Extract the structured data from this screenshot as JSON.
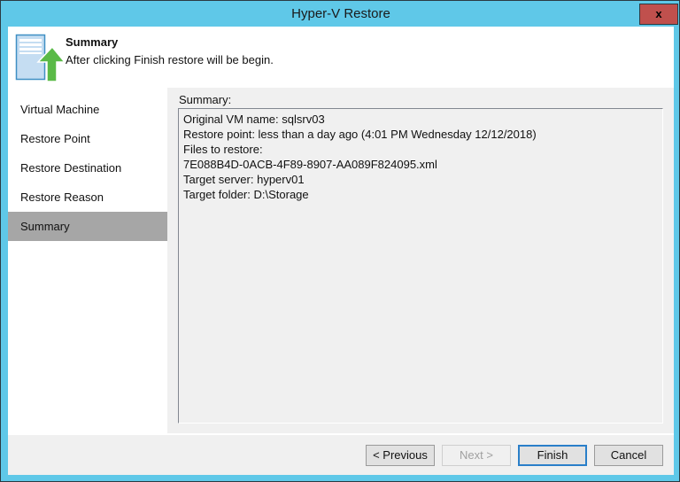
{
  "window": {
    "title": "Hyper-V Restore",
    "close_label": "x",
    "accent_color": "#5fc8e8",
    "close_color": "#c0504d"
  },
  "header": {
    "title": "Summary",
    "subtitle": "After clicking Finish restore will be begin.",
    "icon": "server-restore-icon"
  },
  "sidebar": {
    "items": [
      {
        "label": "Virtual Machine",
        "selected": false
      },
      {
        "label": "Restore Point",
        "selected": false
      },
      {
        "label": "Restore Destination",
        "selected": false
      },
      {
        "label": "Restore Reason",
        "selected": false
      },
      {
        "label": "Summary",
        "selected": true
      }
    ],
    "selected_color": "#a6a6a6"
  },
  "main": {
    "summary_label": "Summary:",
    "summary_lines": [
      "Original VM name: sqlsrv03",
      "Restore point: less than a day ago (4:01 PM Wednesday 12/12/2018)",
      "Files to restore:",
      "7E088B4D-0ACB-4F89-8907-AA089F824095.xml",
      "Target server: hyperv01",
      "Target folder: D:\\Storage"
    ]
  },
  "footer": {
    "previous_label": "< Previous",
    "next_label": "Next >",
    "finish_label": "Finish",
    "cancel_label": "Cancel",
    "next_disabled": true,
    "default_button": "Finish",
    "focus_color": "#2a7fc9"
  }
}
